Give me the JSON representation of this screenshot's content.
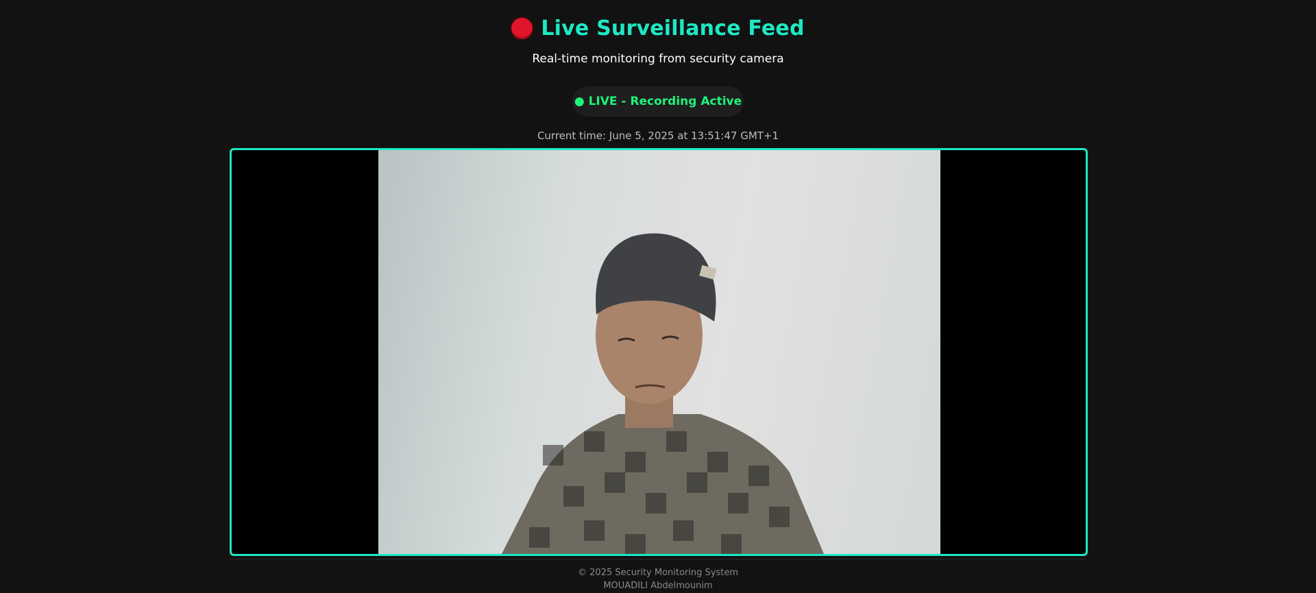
{
  "header": {
    "title": "Live Surveillance Feed",
    "subtitle": "Real-time monitoring from security camera",
    "recording_icon": "red-circle-icon",
    "record_color": "#e0142a",
    "accent_color": "#1de9c4"
  },
  "status": {
    "badge_label": "● LIVE - Recording Active",
    "badge_color": "#1ff27a"
  },
  "clock": {
    "current_time": "Current time: June 5, 2025 at 13:51:47 GMT+1"
  },
  "feed": {
    "description": "camera-feed"
  },
  "footer": {
    "copyright": "© 2025 Security Monitoring System",
    "author": "MOUADILI Abdelmounim"
  }
}
